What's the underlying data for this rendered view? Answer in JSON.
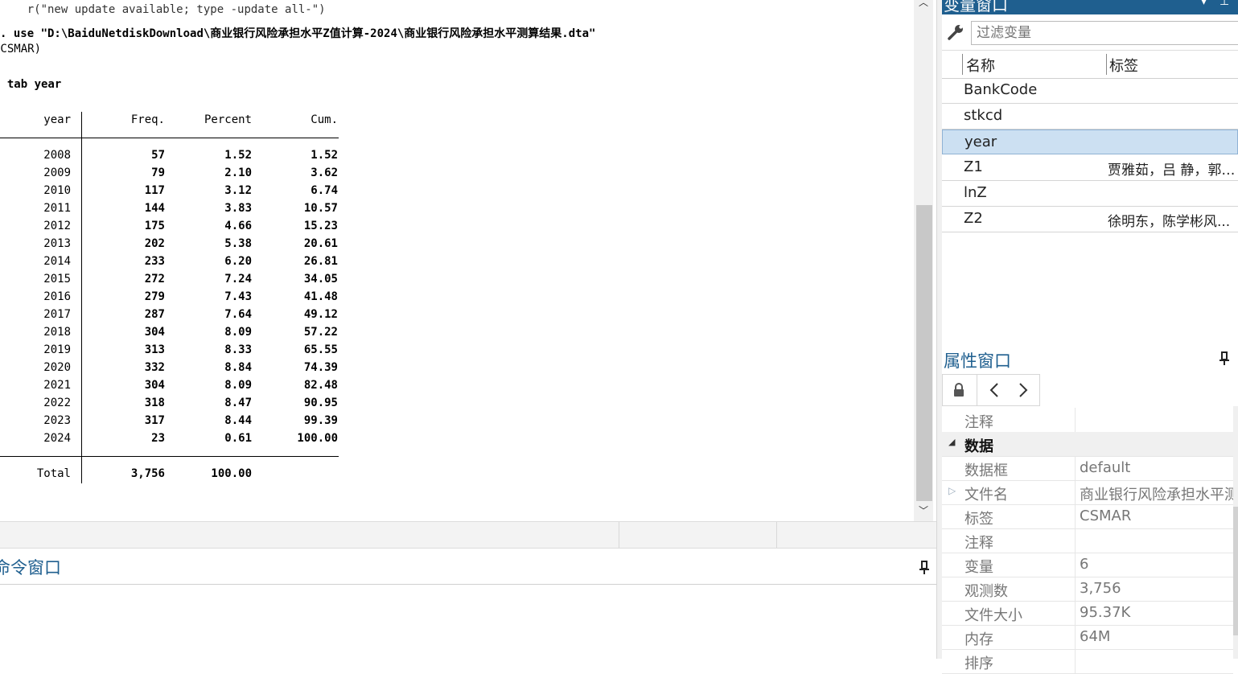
{
  "results": {
    "line_top": "r(\"new update available; type -update all-\")",
    "use_cmd_prefix": ". use ",
    "use_cmd_path": "\"D:\\BaiduNetdiskDownload\\商业银行风险承担水平Z值计算-2024\\商业银行风险承担水平测算结果.dta\"",
    "use_cmd_label": "(CSMAR)",
    "tab_cmd": ". tab year",
    "table": {
      "headers": [
        "year",
        "Freq.",
        "Percent",
        "Cum."
      ],
      "rows": [
        [
          "2008",
          "57",
          "1.52",
          "1.52"
        ],
        [
          "2009",
          "79",
          "2.10",
          "3.62"
        ],
        [
          "2010",
          "117",
          "3.12",
          "6.74"
        ],
        [
          "2011",
          "144",
          "3.83",
          "10.57"
        ],
        [
          "2012",
          "175",
          "4.66",
          "15.23"
        ],
        [
          "2013",
          "202",
          "5.38",
          "20.61"
        ],
        [
          "2014",
          "233",
          "6.20",
          "26.81"
        ],
        [
          "2015",
          "272",
          "7.24",
          "34.05"
        ],
        [
          "2016",
          "279",
          "7.43",
          "41.48"
        ],
        [
          "2017",
          "287",
          "7.64",
          "49.12"
        ],
        [
          "2018",
          "304",
          "8.09",
          "57.22"
        ],
        [
          "2019",
          "313",
          "8.33",
          "65.55"
        ],
        [
          "2020",
          "332",
          "8.84",
          "74.39"
        ],
        [
          "2021",
          "304",
          "8.09",
          "82.48"
        ],
        [
          "2022",
          "318",
          "8.47",
          "90.95"
        ],
        [
          "2023",
          "317",
          "8.44",
          "99.39"
        ],
        [
          "2024",
          "23",
          "0.61",
          "100.00"
        ]
      ],
      "total": [
        "Total",
        "3,756",
        "100.00",
        ""
      ]
    }
  },
  "command_window": {
    "title": "命令窗口"
  },
  "variables_window": {
    "title": "变量窗口",
    "filter_placeholder": "过滤变量",
    "col_name": "名称",
    "col_label": "标签",
    "variables": [
      {
        "name": "BankCode",
        "label": ""
      },
      {
        "name": "stkcd",
        "label": ""
      },
      {
        "name": "year",
        "label": ""
      },
      {
        "name": "Z1",
        "label": "贾雅茹，吕 静，郭 ..."
      },
      {
        "name": "lnZ",
        "label": ""
      },
      {
        "name": "Z2",
        "label": "徐明东，陈学彬风..."
      }
    ],
    "selected_index": 2
  },
  "properties_window": {
    "title": "属性窗口",
    "rows": [
      {
        "key": "注释",
        "value": "",
        "group": false
      },
      {
        "key": "数据",
        "value": "",
        "group": true
      },
      {
        "key": "数据框",
        "value": "default",
        "group": false
      },
      {
        "key": "文件名",
        "value": "商业银行风险承担水平测",
        "group": false
      },
      {
        "key": "标签",
        "value": "CSMAR",
        "group": false
      },
      {
        "key": "注释",
        "value": "",
        "group": false
      },
      {
        "key": "变量",
        "value": "6",
        "group": false
      },
      {
        "key": "观测数",
        "value": "3,756",
        "group": false
      },
      {
        "key": "文件大小",
        "value": "95.37K",
        "group": false
      },
      {
        "key": "内存",
        "value": "64M",
        "group": false
      },
      {
        "key": "排序",
        "value": "",
        "group": false
      }
    ]
  },
  "icons": {
    "filter": "wrench-icon",
    "lock": "lock-icon",
    "back": "chevron-left-icon",
    "forward": "chevron-right-icon",
    "pin": "pin-icon"
  },
  "colors": {
    "accent": "#1f5f8f",
    "selection": "#cce0f2",
    "link": "#1f3ed4"
  }
}
